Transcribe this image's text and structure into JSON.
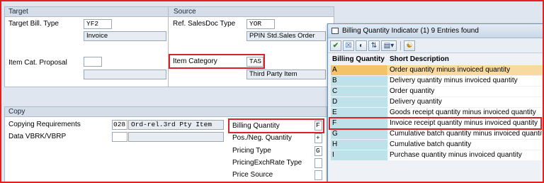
{
  "target": {
    "header": "Target",
    "bill_type_label": "Target Bill. Type",
    "bill_type_value": "YF2",
    "bill_type_desc": "Invoice",
    "item_cat_label": "Item Cat. Proposal",
    "item_cat_value": "",
    "item_cat_desc": ""
  },
  "source": {
    "header": "Source",
    "ref_doc_label": "Ref. SalesDoc Type",
    "ref_doc_value": "YOR",
    "ref_doc_desc": "PPIN Std.Sales Order",
    "item_category_label": "Item Category",
    "item_category_value": "TAS",
    "item_category_desc": "Third Party Item"
  },
  "copy": {
    "header": "Copy",
    "copy_req_label": "Copying Requirements",
    "copy_req_value": "028",
    "copy_req_desc": "Ord-rel.3rd Pty Item",
    "data_vbrk_label": "Data VBRK/VBRP",
    "data_vbrk_value": "",
    "data_vbrk_desc": "",
    "billing_qty_label": "Billing Quantity",
    "billing_qty_value": "F",
    "pos_neg_label": "Pos./Neg. Quantity",
    "pos_neg_value": "+",
    "pricing_type_label": "Pricing Type",
    "pricing_type_value": "G",
    "pricing_exch_label": "PricingExchRate Type",
    "pricing_exch_value": "",
    "price_source_label": "Price Source",
    "price_source_value": ""
  },
  "popup": {
    "title": "Billing Quantity Indicator (1)    9 Entries found",
    "col_key": "Billing Quantity",
    "col_desc": "Short Description",
    "selected_key": "A",
    "highlighted_key": "F",
    "rows": [
      {
        "key": "A",
        "desc": "Order quantity minus invoiced quantity"
      },
      {
        "key": "B",
        "desc": "Delivery quantity minus invoiced quantity"
      },
      {
        "key": "C",
        "desc": "Order quantity"
      },
      {
        "key": "D",
        "desc": "Delivery quantity"
      },
      {
        "key": "E",
        "desc": "Goods receipt quantity minus invoiced quantity"
      },
      {
        "key": "F",
        "desc": "Invoice receipt quantity minus invoiced quantity"
      },
      {
        "key": "G",
        "desc": "Cumulative batch quantity minus invoiced quantity"
      },
      {
        "key": "H",
        "desc": "Cumulative batch quantity"
      },
      {
        "key": "I",
        "desc": "Purchase quantity minus invoiced quantity"
      }
    ],
    "toolbar_icons": [
      "check-icon",
      "cancel-icon",
      "binoculars-icon",
      "sort-icon",
      "filter-icon",
      "help-icon"
    ]
  },
  "colors": {
    "highlight": "#d9212b",
    "selected_row": "#f3c36a",
    "key_column": "#bfe2ea"
  }
}
